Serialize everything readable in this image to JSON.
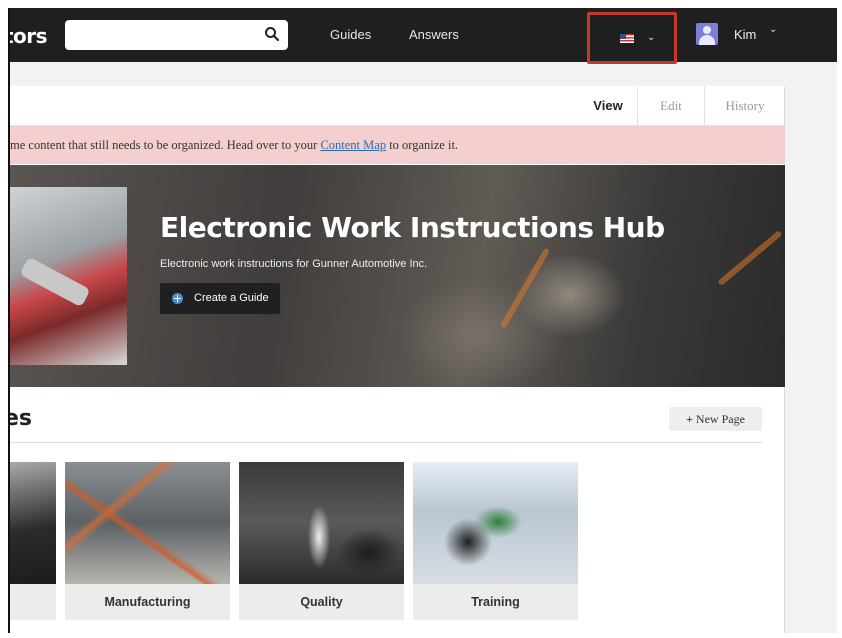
{
  "nav": {
    "brand": "tors",
    "search_placeholder": "",
    "links": [
      "Guides",
      "Answers"
    ],
    "user_name": "Kim"
  },
  "tabs": [
    "View",
    "Edit",
    "History"
  ],
  "alert": {
    "text_before": "me content that still needs to be organized. Head over to your ",
    "link": "Content Map",
    "text_after": " to organize it."
  },
  "hero": {
    "title": "Electronic Work Instructions Hub",
    "subtitle": "Electronic work instructions for Gunner Automotive Inc.",
    "button": "Create a Guide"
  },
  "pages": {
    "title": "es",
    "new_page": "New Page",
    "tiles": [
      "",
      "Manufacturing",
      "Quality",
      "Training"
    ]
  },
  "colors": {
    "topbar": "#1f1f1f",
    "highlight": "#c0392b",
    "alert_bg": "#f3d0cf",
    "link": "#2b6bb3"
  }
}
